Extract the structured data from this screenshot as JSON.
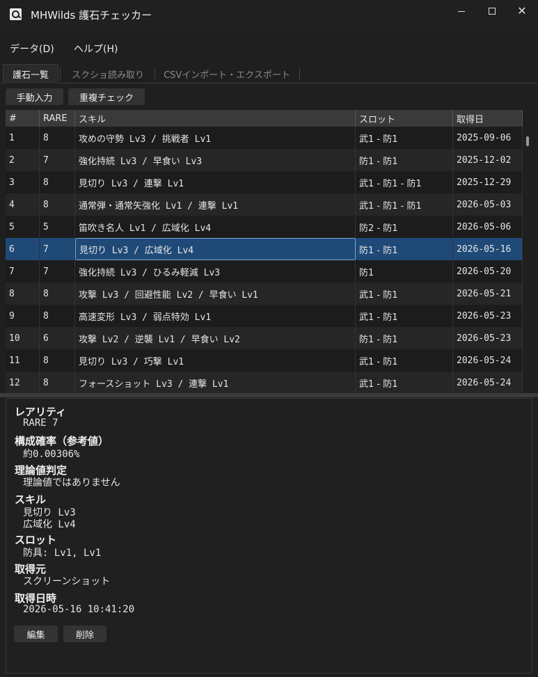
{
  "window": {
    "title": "MHWilds 護石チェッカー"
  },
  "menu": {
    "data": "データ(D)",
    "help": "ヘルプ(H)"
  },
  "tabs": [
    {
      "label": "護石一覧",
      "active": true
    },
    {
      "label": "スクショ読み取り",
      "active": false
    },
    {
      "label": "CSVインポート・エクスポート",
      "active": false
    }
  ],
  "toolbar": {
    "manual_input": "手動入力",
    "duplicate_check": "重複チェック"
  },
  "table": {
    "columns": [
      "#",
      "RARE",
      "スキル",
      "スロット",
      "取得日"
    ],
    "rows": [
      {
        "num": "1",
        "rare": "8",
        "skill": "攻めの守勢 Lv3 / 挑戦者 Lv1",
        "slot": "武1 - 防1",
        "date": "2025-09-06"
      },
      {
        "num": "2",
        "rare": "7",
        "skill": "強化持続 Lv3 / 早食い Lv3",
        "slot": "防1 - 防1",
        "date": "2025-12-02"
      },
      {
        "num": "3",
        "rare": "8",
        "skill": "見切り Lv3 / 連撃 Lv1",
        "slot": "武1 - 防1 - 防1",
        "date": "2025-12-29"
      },
      {
        "num": "4",
        "rare": "8",
        "skill": "通常弾・通常矢強化 Lv1 / 連撃 Lv1",
        "slot": "武1 - 防1 - 防1",
        "date": "2026-05-03"
      },
      {
        "num": "5",
        "rare": "5",
        "skill": "笛吹き名人 Lv1 / 広域化 Lv4",
        "slot": "防2 - 防1",
        "date": "2026-05-06"
      },
      {
        "num": "6",
        "rare": "7",
        "skill": "見切り Lv3 / 広域化 Lv4",
        "slot": "防1 - 防1",
        "date": "2026-05-16"
      },
      {
        "num": "7",
        "rare": "7",
        "skill": "強化持続 Lv3 / ひるみ軽減 Lv3",
        "slot": "防1",
        "date": "2026-05-20"
      },
      {
        "num": "8",
        "rare": "8",
        "skill": "攻撃 Lv3 / 回避性能 Lv2 / 早食い Lv1",
        "slot": "武1 - 防1",
        "date": "2026-05-21"
      },
      {
        "num": "9",
        "rare": "8",
        "skill": "高速変形 Lv3 / 弱点特効 Lv1",
        "slot": "武1 - 防1",
        "date": "2026-05-23"
      },
      {
        "num": "10",
        "rare": "6",
        "skill": "攻撃 Lv2 / 逆襲 Lv1 / 早食い Lv2",
        "slot": "防1 - 防1",
        "date": "2026-05-23"
      },
      {
        "num": "11",
        "rare": "8",
        "skill": "見切り Lv3 / 巧撃 Lv1",
        "slot": "武1 - 防1",
        "date": "2026-05-24"
      },
      {
        "num": "12",
        "rare": "8",
        "skill": "フォースショット Lv3 / 連撃 Lv1",
        "slot": "武1 - 防1",
        "date": "2026-05-24"
      }
    ],
    "selected_index": 5
  },
  "detail": {
    "rarity_label": "レアリティ",
    "rarity_value": "RARE 7",
    "probability_label": "構成確率（参考値）",
    "probability_value": "約0.00306%",
    "theory_label": "理論値判定",
    "theory_value": "理論値ではありません",
    "skill_label": "スキル",
    "skill_values": [
      "見切り Lv3",
      "広域化 Lv4"
    ],
    "slot_label": "スロット",
    "slot_value": "防具: Lv1, Lv1",
    "source_label": "取得元",
    "source_value": "スクリーンショット",
    "datetime_label": "取得日時",
    "datetime_value": "2026-05-16 10:41:20",
    "edit_button": "編集",
    "delete_button": "削除"
  },
  "colors": {
    "background": "#1f1f1f",
    "selected_row": "#1f4a78",
    "header": "#3a3a3a"
  }
}
